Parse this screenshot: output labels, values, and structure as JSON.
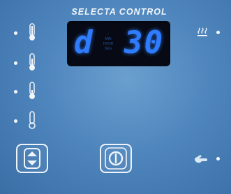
{
  "panel": {
    "brand": "SELECTA CONTROL"
  },
  "display": {
    "left_char": "d",
    "right_value": "30",
    "mid_labels": [
      "▪",
      "MIN",
      "HOUR",
      "SEG"
    ]
  },
  "icons": {
    "thermometer_levels": [
      "thermometer-full-icon",
      "thermometer-high-icon",
      "thermometer-mid-icon",
      "thermometer-low-icon"
    ],
    "heat": "heat-waves-icon",
    "hand": "hand-pointer-icon",
    "power": "power-icon",
    "updown": "up-down-arrows-icon"
  },
  "colors": {
    "panel": "#4f86bd",
    "display_bg": "#070a14",
    "segment": "#2f7cff",
    "foreground": "#f2f6fb"
  }
}
